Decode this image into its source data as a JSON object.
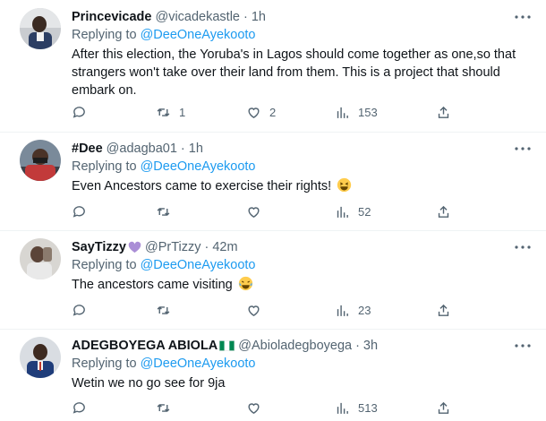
{
  "tweets": [
    {
      "name": "Princevicade",
      "handle": "@vicadekastle",
      "time": "1h",
      "replying_prefix": "Replying to ",
      "replying_to": "@DeeOneAyekooto",
      "text": "After this election, the Yoruba's in Lagos should come together as one,so that strangers won't take over their land from them. This is a project that should embark on.",
      "retweets": "1",
      "likes": "2",
      "views": "153"
    },
    {
      "name": "#Dee",
      "handle": "@adagba01",
      "time": "1h",
      "replying_prefix": "Replying to ",
      "replying_to": "@DeeOneAyekooto",
      "text": "Even Ancestors came to exercise their rights!",
      "text_emoji": "grinning-squinting-face-emoji",
      "retweets": "",
      "likes": "",
      "views": "52"
    },
    {
      "name": "SayTizzy",
      "name_emoji": "purple-heart-emoji",
      "handle": "@PrTizzy",
      "time": "42m",
      "replying_prefix": "Replying to ",
      "replying_to": "@DeeOneAyekooto",
      "text": "The ancestors came visiting",
      "text_emoji": "face-with-tears-of-joy-emoji",
      "retweets": "",
      "likes": "",
      "views": "23"
    },
    {
      "name": "ADEGBOYEGA ABIOLA",
      "name_emoji": "nigeria-flag-emoji",
      "handle": "@Abioladegboyega",
      "time": "3h",
      "replying_prefix": "Replying to ",
      "replying_to": "@DeeOneAyekooto",
      "text": "Wetin we no go see for 9ja",
      "retweets": "",
      "likes": "",
      "views": "513"
    }
  ],
  "separator": "·",
  "colors": {
    "link": "#1d9bf0",
    "secondary_text": "#536471",
    "primary_text": "#0f1419",
    "divider": "#eff3f4"
  }
}
